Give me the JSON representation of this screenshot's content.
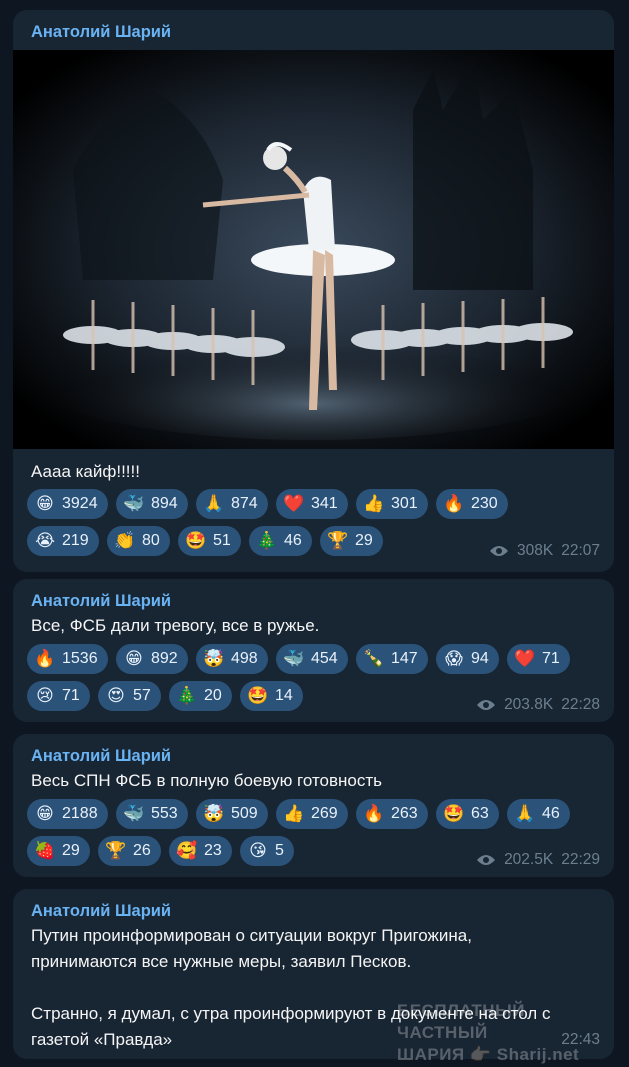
{
  "messages": [
    {
      "author": "Анатолий Шарий",
      "text": "Аааа кайф!!!!!",
      "reactions_row1": [
        {
          "emoji": "😁",
          "icon": "grin-icon",
          "count": "3924"
        },
        {
          "emoji": "🐳",
          "icon": "whale-icon",
          "count": "894"
        },
        {
          "emoji": "🙏",
          "icon": "pray-icon",
          "count": "874"
        },
        {
          "emoji": "❤️",
          "icon": "heart-icon",
          "count": "341"
        },
        {
          "emoji": "👍",
          "icon": "thumbs-up-icon",
          "count": "301"
        },
        {
          "emoji": "🔥",
          "icon": "fire-icon",
          "count": "230"
        }
      ],
      "reactions_row2": [
        {
          "emoji": "😭",
          "icon": "crying-icon",
          "count": "219"
        },
        {
          "emoji": "👏",
          "icon": "clap-icon",
          "count": "80"
        },
        {
          "emoji": "🤩",
          "icon": "star-struck-icon",
          "count": "51"
        },
        {
          "emoji": "🎄",
          "icon": "tree-icon",
          "count": "46"
        },
        {
          "emoji": "🏆",
          "icon": "trophy-icon",
          "count": "29"
        }
      ],
      "views": "308K",
      "time": "22:07"
    },
    {
      "author": "Анатолий Шарий",
      "text": "Все, ФСБ дали тревогу, все в ружье.",
      "reactions_row1": [
        {
          "emoji": "🔥",
          "icon": "fire-icon",
          "count": "1536"
        },
        {
          "emoji": "😁",
          "icon": "grin-icon",
          "count": "892"
        },
        {
          "emoji": "🤯",
          "icon": "mind-blown-icon",
          "count": "498"
        },
        {
          "emoji": "🐳",
          "icon": "whale-icon",
          "count": "454"
        },
        {
          "emoji": "🍾",
          "icon": "champagne-icon",
          "count": "147"
        },
        {
          "emoji": "😱",
          "icon": "scream-icon",
          "count": "94"
        },
        {
          "emoji": "❤️",
          "icon": "heart-icon",
          "count": "71"
        }
      ],
      "reactions_row2": [
        {
          "emoji": "😢",
          "icon": "sad-icon",
          "count": "71"
        },
        {
          "emoji": "😍",
          "icon": "heart-eyes-icon",
          "count": "57"
        },
        {
          "emoji": "🎄",
          "icon": "tree-icon",
          "count": "20"
        },
        {
          "emoji": "🤩",
          "icon": "star-struck-icon",
          "count": "14"
        }
      ],
      "views": "203.8K",
      "time": "22:28"
    },
    {
      "author": "Анатолий Шарий",
      "text": "Весь СПН ФСБ в полную боевую готовность",
      "reactions_row1": [
        {
          "emoji": "😁",
          "icon": "grin-icon",
          "count": "2188"
        },
        {
          "emoji": "🐳",
          "icon": "whale-icon",
          "count": "553"
        },
        {
          "emoji": "🤯",
          "icon": "mind-blown-icon",
          "count": "509"
        },
        {
          "emoji": "👍",
          "icon": "thumbs-up-icon",
          "count": "269"
        },
        {
          "emoji": "🔥",
          "icon": "fire-icon",
          "count": "263"
        },
        {
          "emoji": "🤩",
          "icon": "star-struck-icon",
          "count": "63"
        },
        {
          "emoji": "🙏",
          "icon": "pray-icon",
          "count": "46"
        }
      ],
      "reactions_row2": [
        {
          "emoji": "🍓",
          "icon": "strawberry-icon",
          "count": "29"
        },
        {
          "emoji": "🏆",
          "icon": "trophy-icon",
          "count": "26"
        },
        {
          "emoji": "🥰",
          "icon": "smiling-hearts-icon",
          "count": "23"
        },
        {
          "emoji": "😘",
          "icon": "kiss-icon",
          "count": "5"
        }
      ],
      "views": "202.5K",
      "time": "22:29"
    },
    {
      "author": "Анатолий Шарий",
      "text": "Путин проинформирован о ситуации вокруг Пригожина,\nпринимаются все нужные меры, заявил Песков.\n\nСтранно, я думал, с утра проинформируют в документе на стол с\nгазетой «Правда»",
      "time": "22:43"
    }
  ],
  "watermark": {
    "line1": "БЕСПЛАТНЫЙ ЧАСТНЫЙ",
    "line2": "ШАРИЯ 👉🏻 Sharij.net"
  },
  "colors": {
    "background": "#0e1621",
    "bubble": "#182533",
    "author": "#6ab3f3",
    "reaction_pill": "#2b5278",
    "meta": "#6d7f8f"
  }
}
